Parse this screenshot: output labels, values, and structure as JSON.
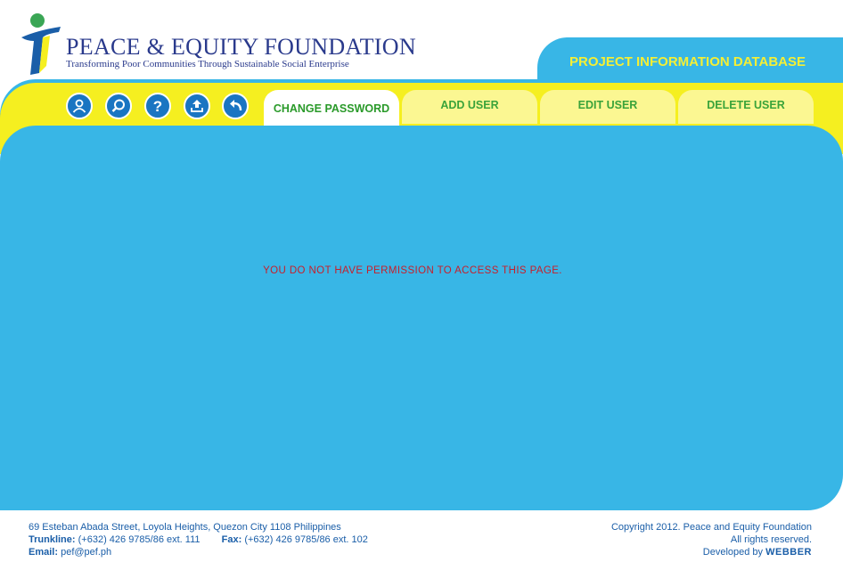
{
  "header": {
    "org_name": "PEACE & EQUITY FOUNDATION",
    "tagline": "Transforming Poor Communities Through Sustainable Social Enterprise",
    "app_title": "PROJECT INFORMATION DATABASE"
  },
  "nav": {
    "icons": [
      {
        "name": "user-icon"
      },
      {
        "name": "search-icon"
      },
      {
        "name": "help-icon"
      },
      {
        "name": "upload-icon"
      },
      {
        "name": "back-icon"
      }
    ],
    "tabs": [
      {
        "label": "CHANGE PASSWORD",
        "active": true
      },
      {
        "label": "ADD USER",
        "active": false
      },
      {
        "label": "EDIT USER",
        "active": false
      },
      {
        "label": "DELETE USER",
        "active": false
      }
    ]
  },
  "content": {
    "message": "YOU DO NOT HAVE PERMISSION TO ACCESS THIS PAGE."
  },
  "footer": {
    "address": "69 Esteban Abada Street, Loyola Heights, Quezon City 1108 Philippines",
    "trunkline_label": "Trunkline:",
    "trunkline": "(+632) 426 9785/86 ext. 111",
    "fax_label": "Fax:",
    "fax": "(+632) 426 9785/86 ext. 102",
    "email_label": "Email:",
    "email": "pef@pef.ph",
    "copyright": "Copyright 2012. Peace and Equity Foundation",
    "rights": "All rights reserved.",
    "developed_by": "Developed by",
    "developer": "WEBBER"
  },
  "colors": {
    "accent_blue": "#38b6e6",
    "nav_yellow": "#f5ef20",
    "tab_yellow": "#fbf792",
    "error_red": "#c81e2a",
    "brand_navy": "#2a3a8c"
  }
}
